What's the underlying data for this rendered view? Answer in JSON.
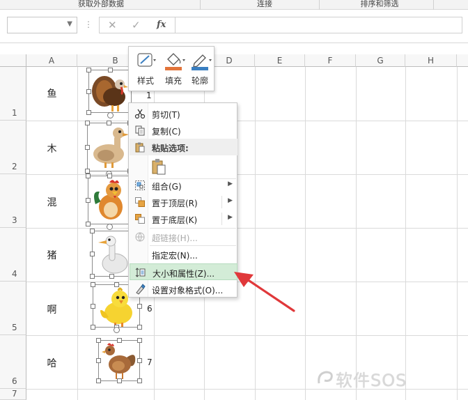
{
  "ribbon": {
    "groups": [
      {
        "label": "获取外部数据",
        "icon": "group-label"
      },
      {
        "label": "连接",
        "icon": "group-label"
      },
      {
        "label": "排序和筛选",
        "icon": "group-label"
      }
    ]
  },
  "formula_bar": {
    "name_box_value": "",
    "cancel_symbol": "✕",
    "enter_symbol": "✓",
    "fx_label": "fx",
    "formula_value": ""
  },
  "columns": [
    "A",
    "B",
    "C",
    "D",
    "E",
    "F",
    "G",
    "H"
  ],
  "rows": [
    {
      "num": "1",
      "a": "鱼",
      "n": "1"
    },
    {
      "num": "2",
      "a": "木",
      "n": ""
    },
    {
      "num": "3",
      "a": "混",
      "n": ""
    },
    {
      "num": "4",
      "a": "猪",
      "n": ""
    },
    {
      "num": "5",
      "a": "啊",
      "n": "6"
    },
    {
      "num": "6",
      "a": "哈",
      "n": "7"
    },
    {
      "num": "7",
      "a": "",
      "n": ""
    }
  ],
  "pictures": [
    {
      "name": "turkey-image"
    },
    {
      "name": "duck-image"
    },
    {
      "name": "rooster-image"
    },
    {
      "name": "goose-image"
    },
    {
      "name": "chick-image"
    },
    {
      "name": "hen-image"
    }
  ],
  "mini_toolbar": {
    "style": "样式",
    "fill": "填充",
    "outline": "轮廓",
    "colors": {
      "fill": "#e2743a",
      "outline": "#3a7fc1"
    }
  },
  "context_menu": {
    "cut": "剪切(T)",
    "copy": "复制(C)",
    "paste_options": "粘贴选项:",
    "group": "组合(G)",
    "bring_to_front": "置于顶层(R)",
    "send_to_back": "置于底层(K)",
    "hyperlink": "超链接(H)...",
    "assign_macro": "指定宏(N)...",
    "size_properties": "大小和属性(Z)...",
    "format_object": "设置对象格式(O)..."
  },
  "watermark": "软件SOS",
  "colors": {
    "highlight": "#d3ecd7",
    "arrow": "#e0383a"
  }
}
